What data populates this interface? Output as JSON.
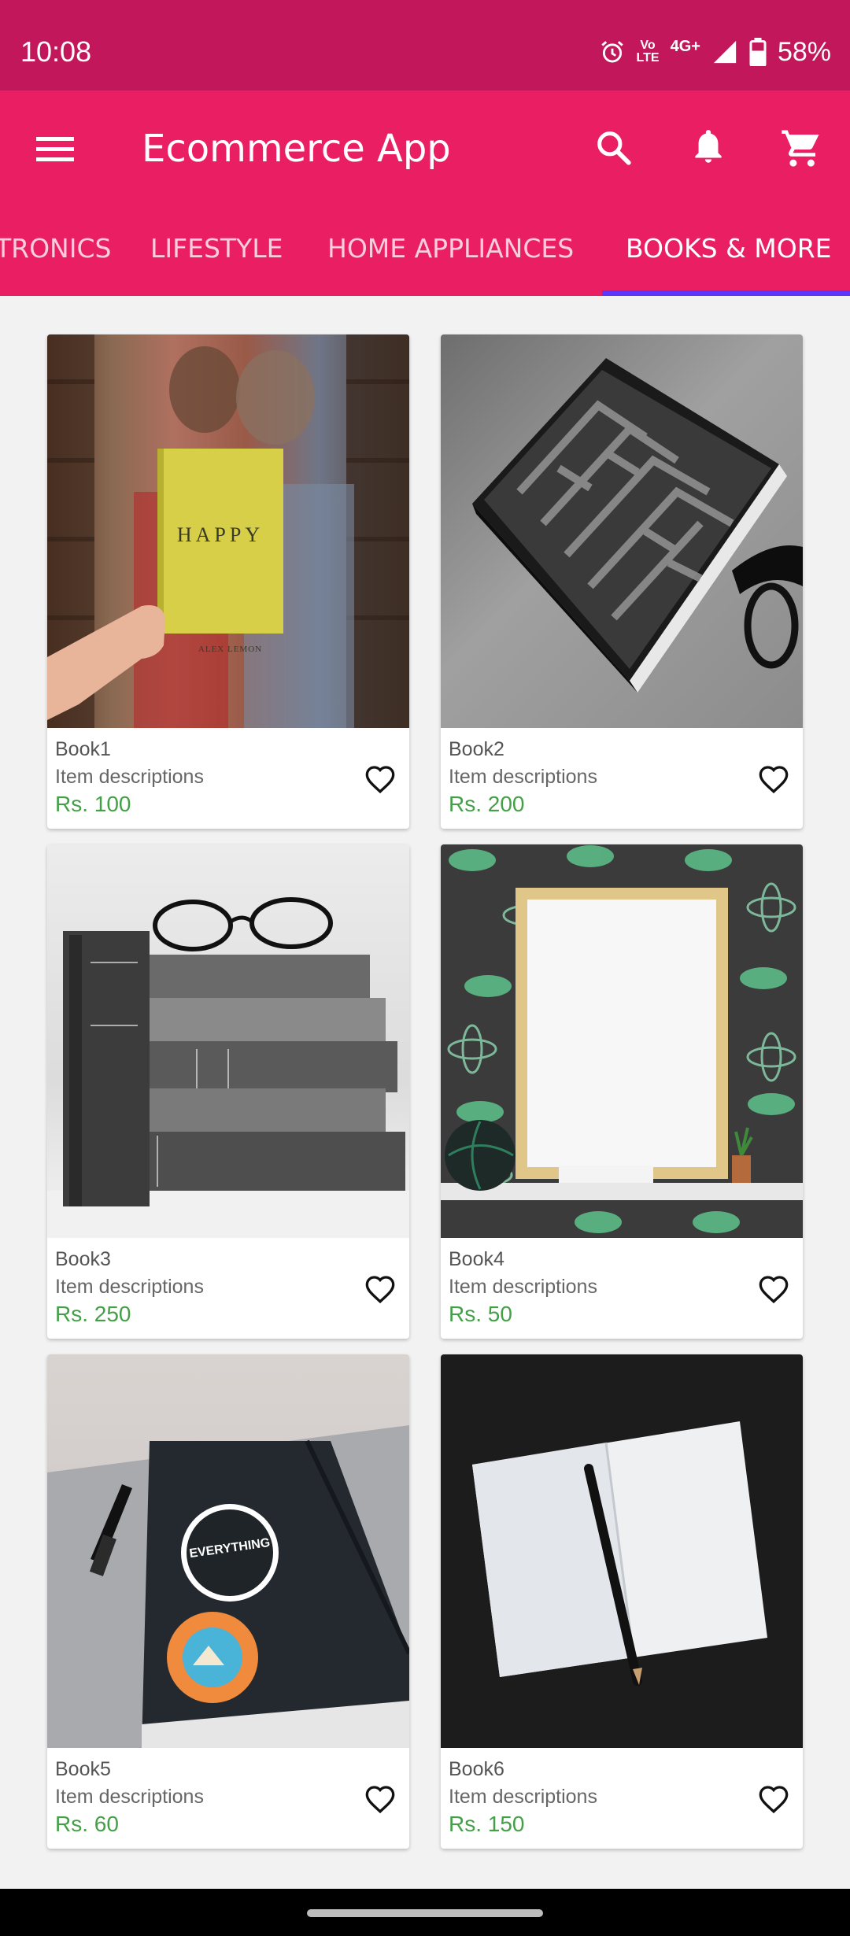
{
  "status_bar": {
    "time": "10:08",
    "network": "4G+",
    "volte_top": "Vo",
    "volte_bottom": "LTE",
    "battery": "58%"
  },
  "app_bar": {
    "title": "Ecommerce App",
    "icons": [
      "menu-icon",
      "search-icon",
      "bell-icon",
      "cart-icon"
    ],
    "color": "#e91e63"
  },
  "tabs": {
    "items": [
      "TRONICS",
      "LIFESTYLE",
      "HOME APPLIANCES",
      "BOOKS & MORE"
    ],
    "active_index": 3,
    "indicator_color": "#5c35ff"
  },
  "products": [
    {
      "name": "Book1",
      "description": "Item descriptions",
      "price": "Rs. 100",
      "cover_text": "HAPPY",
      "cover_author": "Alex Lemon"
    },
    {
      "name": "Book2",
      "description": "Item descriptions",
      "price": "Rs. 200"
    },
    {
      "name": "Book3",
      "description": "Item descriptions",
      "price": "Rs. 250"
    },
    {
      "name": "Book4",
      "description": "Item descriptions",
      "price": "Rs. 50"
    },
    {
      "name": "Book5",
      "description": "Item descriptions",
      "price": "Rs. 60",
      "sticker_text": "EVERYTHING"
    },
    {
      "name": "Book6",
      "description": "Item descriptions",
      "price": "Rs. 150"
    }
  ],
  "colors": {
    "status_bar": "#c2185b",
    "price": "#43a047",
    "background": "#f2f2f2"
  }
}
